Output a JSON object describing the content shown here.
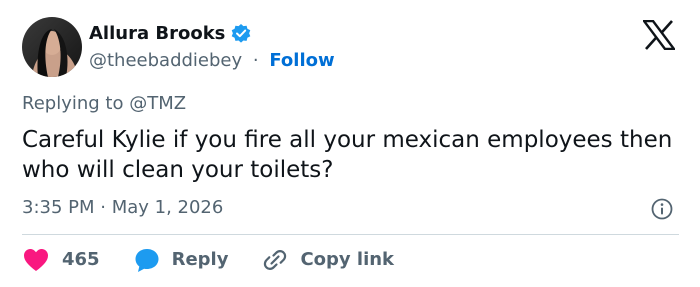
{
  "author": {
    "name": "Allura Brooks",
    "handle": "@theebaddiebey",
    "separator": "·",
    "follow_label": "Follow",
    "verified": true
  },
  "reply_context": "Replying to @TMZ",
  "tweet": {
    "text": "Careful Kylie if you fire all your mexican employees then who will clean your toilets?",
    "timestamp": "3:35 PM · May 1, 2026"
  },
  "actions": {
    "like_count": "465",
    "reply_label": "Reply",
    "copy_label": "Copy link"
  },
  "icons": {
    "verified": "verified-badge-icon",
    "platform": "x-logo-icon",
    "info": "info-icon",
    "like": "heart-icon",
    "reply": "reply-bubble-icon",
    "copy": "link-icon"
  },
  "colors": {
    "text": "#0f1419",
    "secondary": "#536471",
    "follow": "#006fd6",
    "verified": "#1d9bf0",
    "heart": "#f91880",
    "divider": "#cfd9de"
  }
}
